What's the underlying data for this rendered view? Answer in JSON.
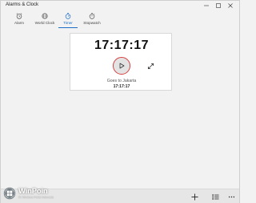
{
  "window": {
    "title": "Alarms & Clock"
  },
  "tabs": [
    {
      "label": "Alarm",
      "icon": "alarm-icon",
      "active": false
    },
    {
      "label": "World Clock",
      "icon": "world-clock-icon",
      "active": false
    },
    {
      "label": "Timer",
      "icon": "timer-icon",
      "active": true
    },
    {
      "label": "Stopwatch",
      "icon": "stopwatch-icon",
      "active": false
    }
  ],
  "timer": {
    "remaining": "17:17:17",
    "goes_to_label": "Goes to Jakarta",
    "goes_to_time": "17:17:17"
  },
  "bottom_bar": {
    "add_icon": "plus-icon",
    "select_icon": "list-select-icon",
    "more_icon": "more-icon"
  },
  "watermark": {
    "name": "WinPoin",
    "tagline": "#1 Windows Portal Indonesia"
  },
  "colors": {
    "accent": "#1e6fc8",
    "play_ring": "#d94040"
  }
}
